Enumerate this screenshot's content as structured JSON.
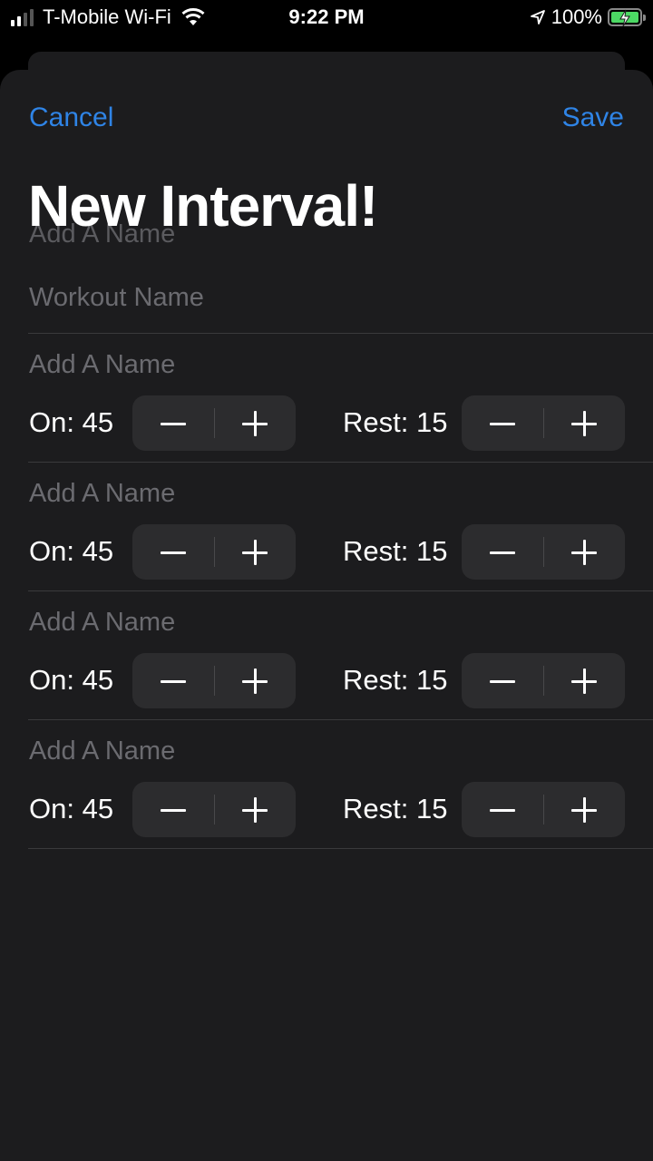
{
  "status_bar": {
    "carrier": "T-Mobile Wi-Fi",
    "time": "9:22 PM",
    "battery": "100%",
    "battery_color": "#4cd964"
  },
  "nav": {
    "cancel_label": "Cancel",
    "save_label": "Save",
    "accent_color": "#2f84e6"
  },
  "title": "New Interval!",
  "ghost_placeholder": "Add A Name",
  "workout_name": {
    "value": "",
    "placeholder": "Workout Name"
  },
  "intervals": [
    {
      "name_placeholder": "Add A Name",
      "on_label": "On: 45",
      "rest_label": "Rest: 15"
    },
    {
      "name_placeholder": "Add A Name",
      "on_label": "On: 45",
      "rest_label": "Rest: 15"
    },
    {
      "name_placeholder": "Add A Name",
      "on_label": "On: 45",
      "rest_label": "Rest: 15"
    },
    {
      "name_placeholder": "Add A Name",
      "on_label": "On: 45",
      "rest_label": "Rest: 15"
    }
  ]
}
